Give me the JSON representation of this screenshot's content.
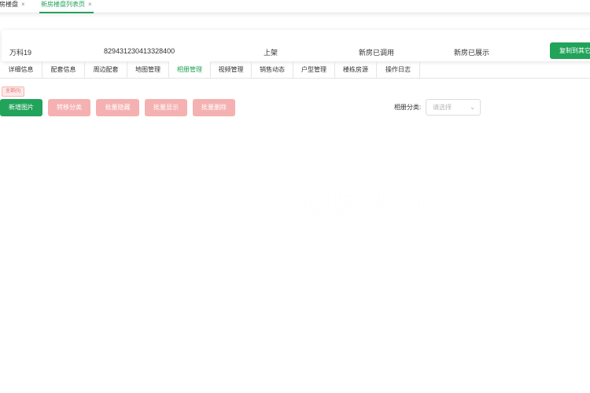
{
  "top_tabs": [
    {
      "label": "房楼盘",
      "close": "×"
    },
    {
      "label": "新房楼盘列表页",
      "close": "×"
    }
  ],
  "info": {
    "name": "万科19",
    "code": "829431230413328400",
    "status": "上架",
    "called": "新房已调用",
    "shown": "新房已展示",
    "copy_button": "复制到其它"
  },
  "sub_tabs": [
    "详细信息",
    "配套信息",
    "周边配套",
    "地图管理",
    "相册管理",
    "视频管理",
    "销售动态",
    "户型管理",
    "楼栋房源",
    "操作日志"
  ],
  "badge": "全部(0)",
  "actions": {
    "add": "新增图片",
    "move": "转移分类",
    "batch_hide": "批量隐藏",
    "batch_show": "批量显示",
    "batch_delete": "批量删除"
  },
  "filter": {
    "label": "相册分类:",
    "placeholder": "请选择"
  },
  "watermark": "WIRE图库水印"
}
